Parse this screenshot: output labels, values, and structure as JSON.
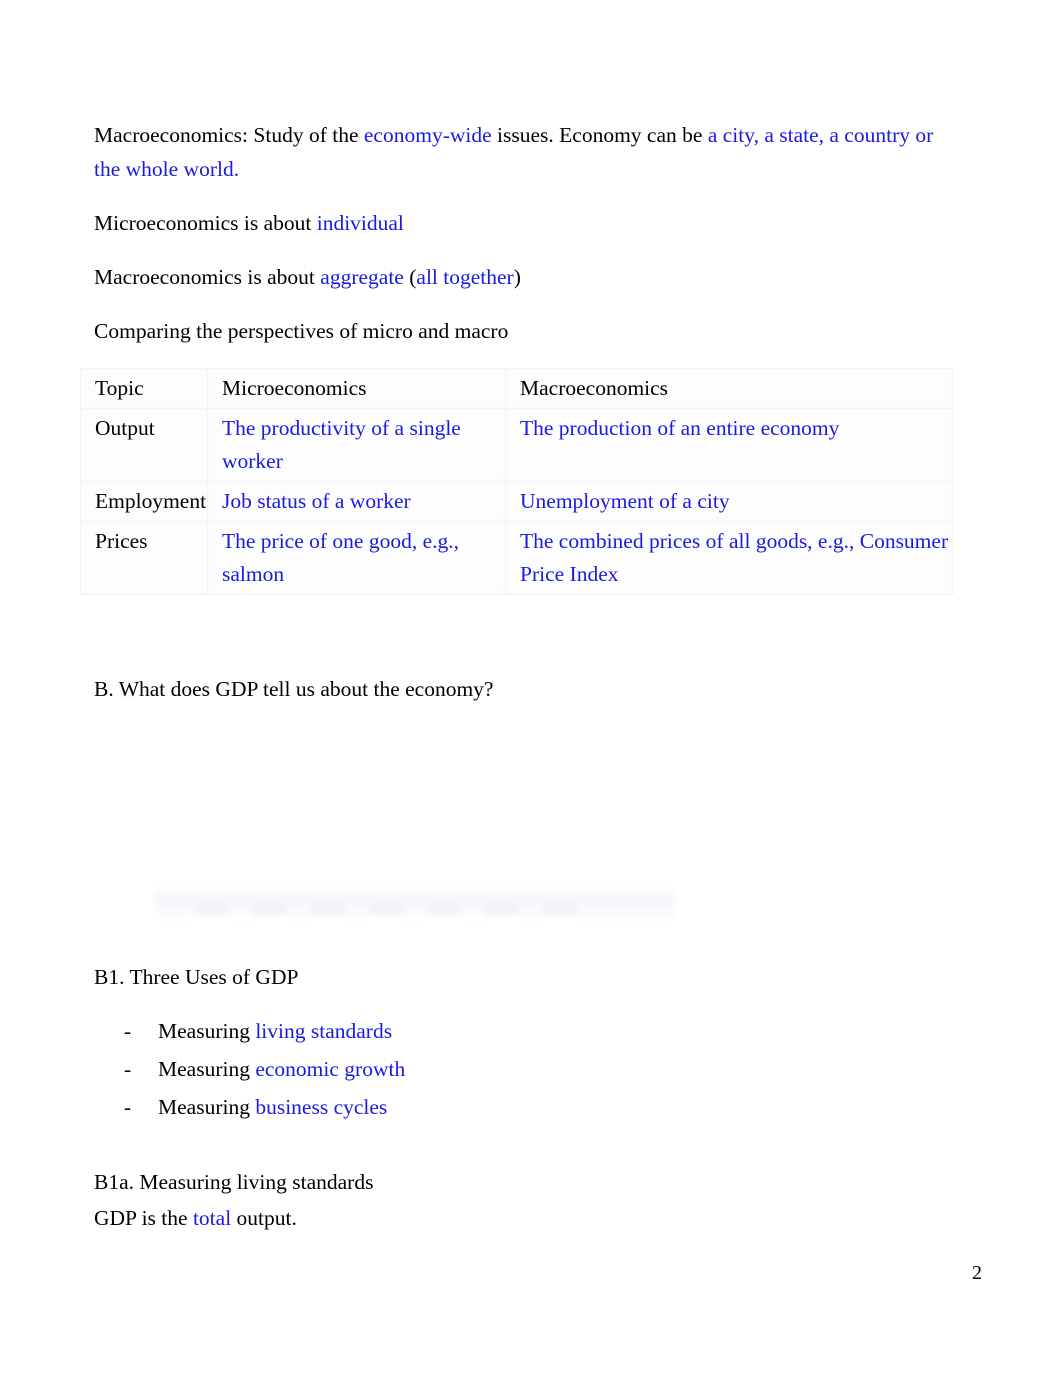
{
  "document": {
    "page_number": "2",
    "accent_blue": "#1a1ae0",
    "text_color": "#000000",
    "background": "#ffffff"
  },
  "intro": {
    "macro_def": {
      "lead": "Macroeconomics: Study of the ",
      "blank1": "economy-wide",
      "mid": " issues. Economy can be ",
      "blank2": "a city, a state, a country or the whole world",
      "end": "."
    },
    "micro_line": {
      "lead": "Microeconomics is about ",
      "blank": "individual"
    },
    "macro_line": {
      "lead": "Macroeconomics is about ",
      "blank1": "aggregate",
      "mid": " (",
      "blank2": "all together",
      "end": ")"
    },
    "comparing_heading": "Comparing the perspectives of micro and macro"
  },
  "comparison_table": {
    "headers": [
      "Topic",
      "Microeconomics",
      "Macroeconomics"
    ],
    "rows": [
      {
        "topic": "Output",
        "micro": "The productivity of a single worker",
        "macro": "The production of an entire economy"
      },
      {
        "topic": "Employment",
        "micro": "Job status of a worker",
        "macro": "Unemployment of a city"
      },
      {
        "topic": "Prices",
        "micro": "The price of one good, e.g., salmon",
        "macro": "The combined prices of all goods, e.g., Consumer Price Index"
      }
    ]
  },
  "section_b": {
    "heading": "B. What does GDP tell us about the economy?"
  },
  "section_b1": {
    "heading": "B1. Three Uses of GDP",
    "dash": "-",
    "items": [
      {
        "lead": "Measuring ",
        "blank": "living standards"
      },
      {
        "lead": "Measuring ",
        "blank": "economic growth"
      },
      {
        "lead": "Measuring ",
        "blank": "business cycles"
      }
    ]
  },
  "section_b1a": {
    "heading": "B1a. Measuring living standards",
    "gdp_line": {
      "lead": "GDP is the ",
      "blank": "total",
      "end": " output."
    }
  }
}
